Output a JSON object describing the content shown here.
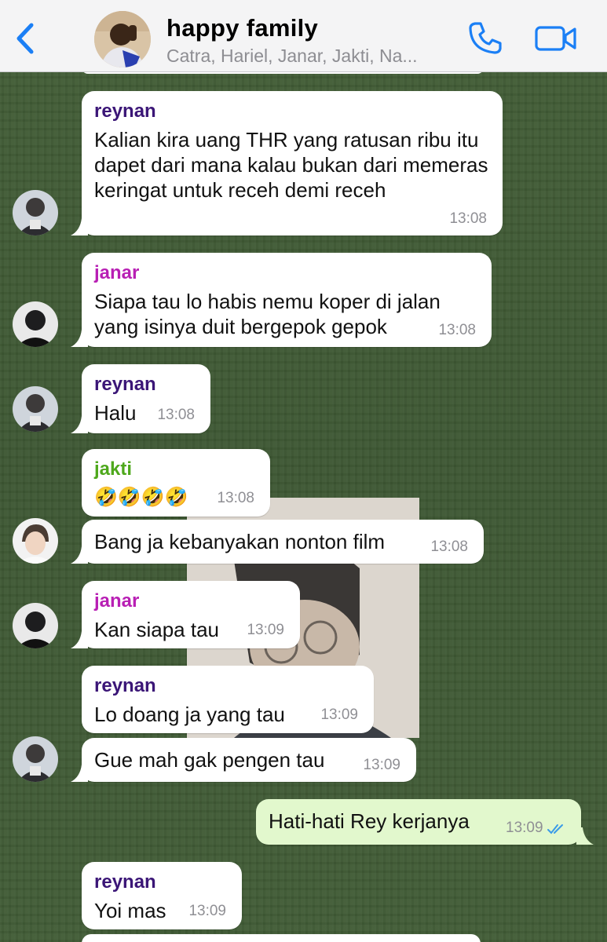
{
  "header": {
    "title": "happy family",
    "members": "Catra, Hariel, Janar, Jakti, Na..."
  },
  "colors": {
    "reynan": "#3b1677",
    "janar": "#b81fb4",
    "jakti": "#4ea81c",
    "accent": "#1b7ff5"
  },
  "messages": [
    {
      "sender": "reynan",
      "text": "Kalian kira uang THR yang ratusan ribu itu dapet dari mana kalau bukan dari memeras keringat untuk receh demi receh",
      "time": "13:08"
    },
    {
      "sender": "janar",
      "text": "Siapa tau lo habis nemu koper di jalan yang isinya duit bergepok gepok",
      "time": "13:08"
    },
    {
      "sender": "reynan",
      "text": "Halu",
      "time": "13:08"
    },
    {
      "sender": "jakti",
      "text": "🤣🤣🤣🤣",
      "time": "13:08"
    },
    {
      "sender": "",
      "text": "Bang ja kebanyakan nonton film",
      "time": "13:08"
    },
    {
      "sender": "janar",
      "text": "Kan siapa tau",
      "time": "13:09"
    },
    {
      "sender": "reynan",
      "text": "Lo doang ja yang tau",
      "time": "13:09"
    },
    {
      "sender": "",
      "text": "Gue mah gak pengen tau",
      "time": "13:09"
    },
    {
      "sender": "",
      "text": "Hati-hati Rey kerjanya",
      "time": "13:09",
      "outgoing": true,
      "status": "read"
    },
    {
      "sender": "reynan",
      "text": "Yoi mas",
      "time": "13:09"
    }
  ]
}
